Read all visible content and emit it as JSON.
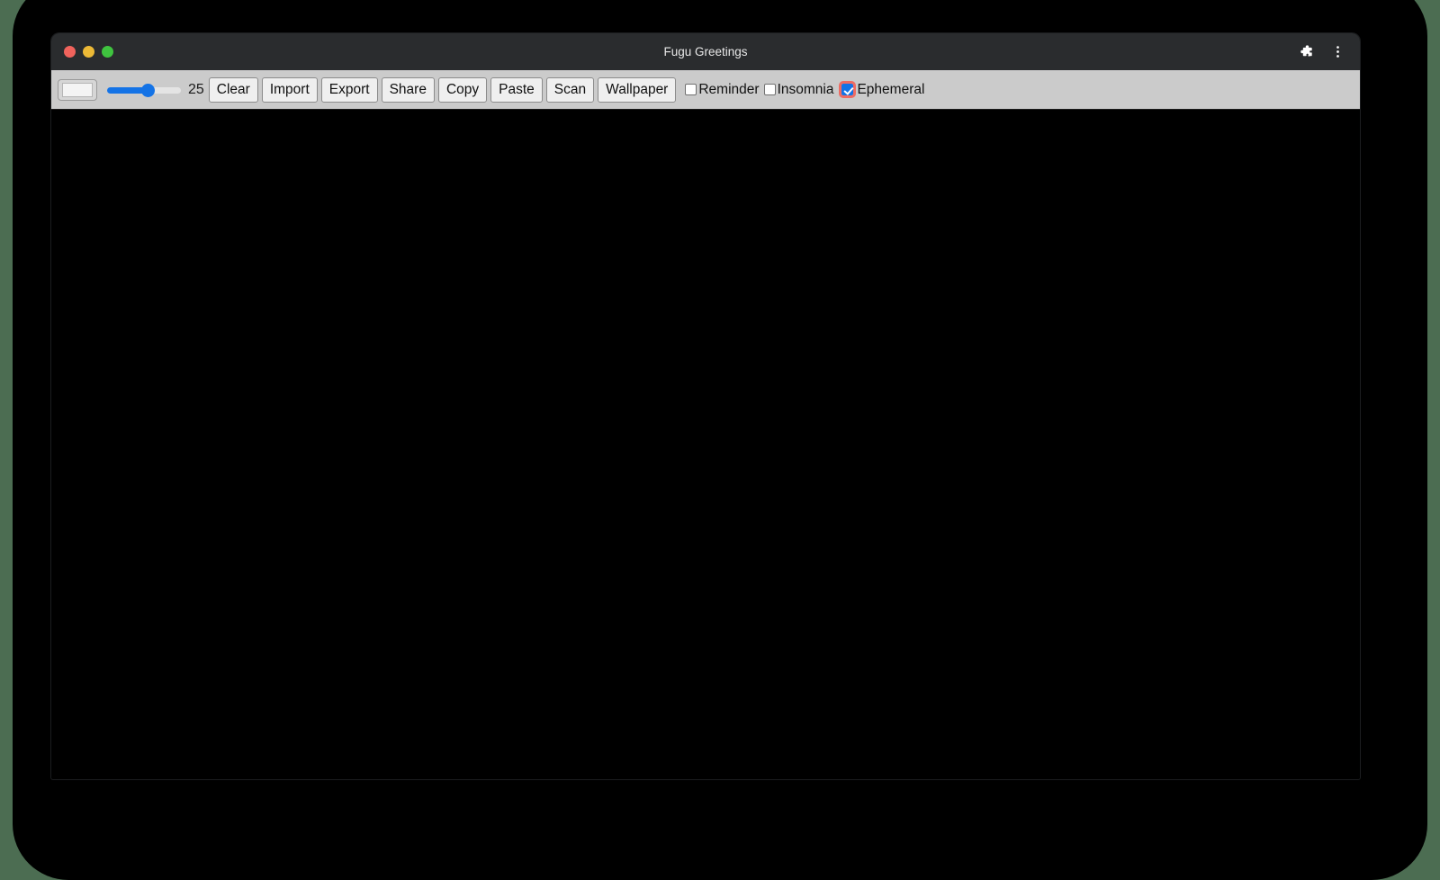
{
  "window": {
    "title": "Fugu Greetings",
    "traffic_lights": [
      "close",
      "minimize",
      "maximize"
    ],
    "titlebar_icons": [
      {
        "name": "extensions-icon",
        "glyph": "puzzle-piece"
      },
      {
        "name": "browser-menu-icon",
        "glyph": "three-dots-vertical"
      }
    ]
  },
  "toolbar": {
    "color_picker": {
      "name": "color-picker",
      "value": "#f4f4f4"
    },
    "slider": {
      "name": "line-width-slider",
      "value": "25",
      "min": "1",
      "max": "50",
      "display_value": "25"
    },
    "buttons": [
      {
        "id": "clear",
        "label": "Clear"
      },
      {
        "id": "import",
        "label": "Import"
      },
      {
        "id": "export",
        "label": "Export"
      },
      {
        "id": "share",
        "label": "Share"
      },
      {
        "id": "copy",
        "label": "Copy"
      },
      {
        "id": "paste",
        "label": "Paste"
      },
      {
        "id": "scan",
        "label": "Scan"
      },
      {
        "id": "wallpaper",
        "label": "Wallpaper"
      }
    ],
    "checkboxes": [
      {
        "id": "reminder",
        "label": "Reminder",
        "checked": false,
        "focused": false
      },
      {
        "id": "insomnia",
        "label": "Insomnia",
        "checked": false,
        "focused": false
      },
      {
        "id": "ephemeral",
        "label": "Ephemeral",
        "checked": true,
        "focused": true
      }
    ]
  },
  "canvas": {
    "name": "drawing-canvas",
    "background": "#000000"
  },
  "colors": {
    "titlebar_bg": "#2a2c2e",
    "toolbar_bg": "#cbcbcb",
    "accent": "#1473e6",
    "focus_ring": "#ef6b62",
    "desktop_bg": "#4c6d52",
    "bezel": "#000000"
  }
}
